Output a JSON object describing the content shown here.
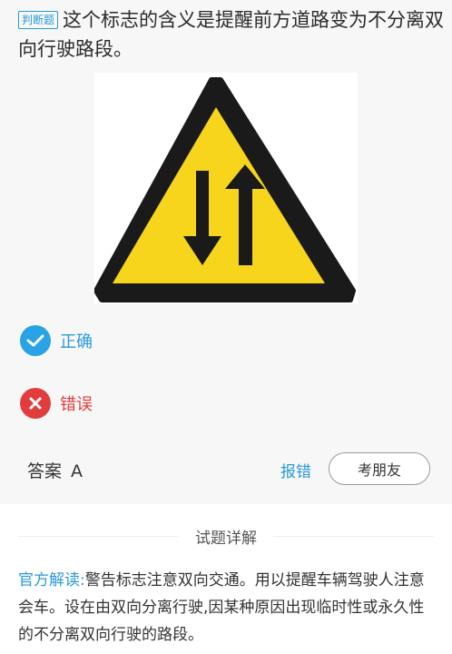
{
  "question": {
    "tag": "判断题",
    "text": "这个标志的含义是提醒前方道路变为不分离双向行驶路段。"
  },
  "sign": {
    "description": "two-way-traffic-warning-sign",
    "colors": {
      "fill": "#f7d51d",
      "border": "#1a1a1a",
      "arrows": "#1a1a1a"
    }
  },
  "options": [
    {
      "label": "正确",
      "icon": "check-icon",
      "color": "#2aa2e6"
    },
    {
      "label": "错误",
      "icon": "close-icon",
      "color": "#e23d3d"
    }
  ],
  "answer": {
    "label": "答案",
    "value": "A"
  },
  "actions": {
    "report_label": "报错",
    "friend_label": "考朋友"
  },
  "detail": {
    "title": "试题详解",
    "explain_label": "官方解读:",
    "explain_text": "警告标志注意双向交通。用以提醒车辆驾驶人注意会车。设在由双向分离行驶,因某种原因出现临时性或永久性的不分离双向行驶的路段。"
  },
  "colors": {
    "accent": "#2a9ad8",
    "error": "#e23d3d",
    "background": "#f7f7f7"
  }
}
